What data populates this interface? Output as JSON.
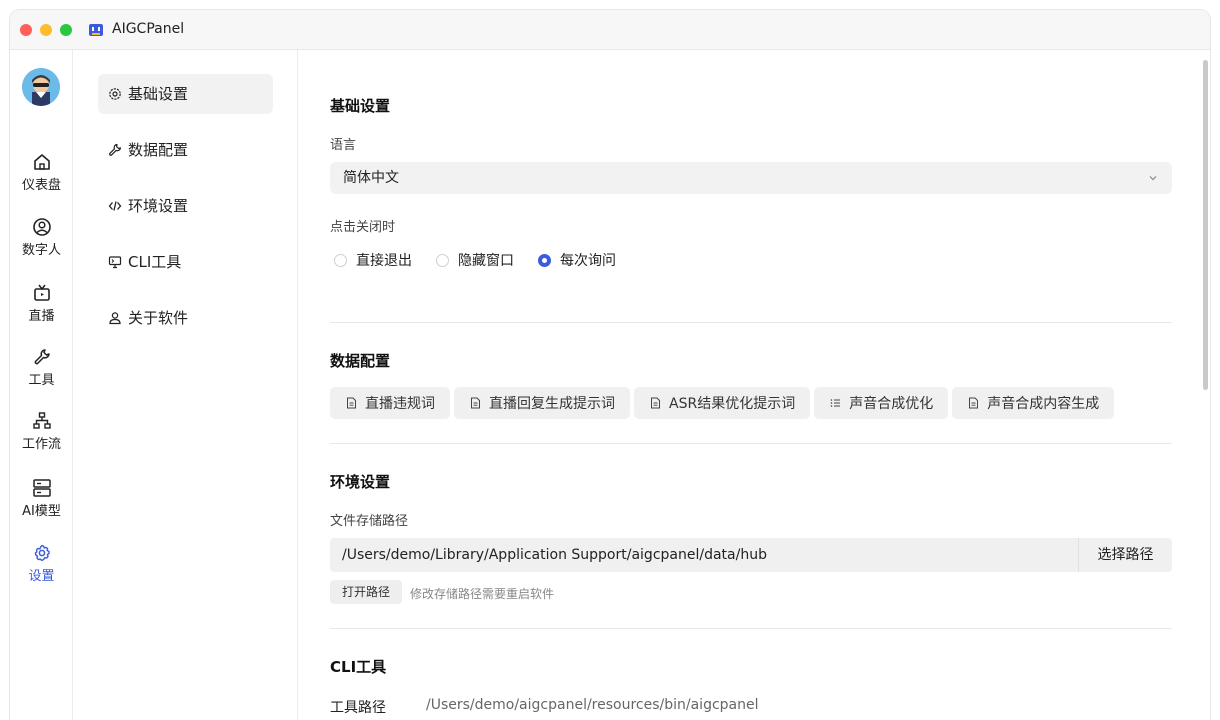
{
  "app": {
    "title": "AIGCPanel"
  },
  "rail": {
    "items": [
      {
        "label": "仪表盘",
        "icon": "home-icon"
      },
      {
        "label": "数字人",
        "icon": "user-circle-icon"
      },
      {
        "label": "直播",
        "icon": "tv-icon"
      },
      {
        "label": "工具",
        "icon": "wrench-icon"
      },
      {
        "label": "工作流",
        "icon": "sitemap-icon"
      },
      {
        "label": "AI模型",
        "icon": "server-icon"
      },
      {
        "label": "设置",
        "icon": "gear-icon",
        "active": true
      }
    ]
  },
  "settings_nav": {
    "items": [
      {
        "label": "基础设置",
        "icon": "gear-icon",
        "active": true
      },
      {
        "label": "数据配置",
        "icon": "wrench-icon"
      },
      {
        "label": "环境设置",
        "icon": "code-icon"
      },
      {
        "label": "CLI工具",
        "icon": "monitor-icon"
      },
      {
        "label": "关于软件",
        "icon": "user-icon"
      }
    ]
  },
  "basic": {
    "title": "基础设置",
    "language_label": "语言",
    "language_value": "简体中文",
    "close_label": "点击关闭时",
    "close_options": [
      "直接退出",
      "隐藏窗口",
      "每次询问"
    ],
    "close_selected": "每次询问"
  },
  "data_config": {
    "title": "数据配置",
    "chips": [
      {
        "label": "直播违规词",
        "icon": "file-icon"
      },
      {
        "label": "直播回复生成提示词",
        "icon": "file-icon"
      },
      {
        "label": "ASR结果优化提示词",
        "icon": "file-icon"
      },
      {
        "label": "声音合成优化",
        "icon": "list-icon"
      },
      {
        "label": "声音合成内容生成",
        "icon": "file-icon"
      }
    ]
  },
  "env": {
    "title": "环境设置",
    "storage_label": "文件存储路径",
    "storage_path": "/Users/demo/Library/Application Support/aigcpanel/data/hub",
    "choose_path": "选择路径",
    "open_path": "打开路径",
    "hint": "修改存储路径需要重启软件"
  },
  "cli": {
    "title": "CLI工具",
    "tool_path_label": "工具路径",
    "tool_path": "/Users/demo/aigcpanel/resources/bin/aigcpanel"
  },
  "colors": {
    "accent": "#3b5bdb",
    "chip_bg": "#f0f0f0"
  }
}
